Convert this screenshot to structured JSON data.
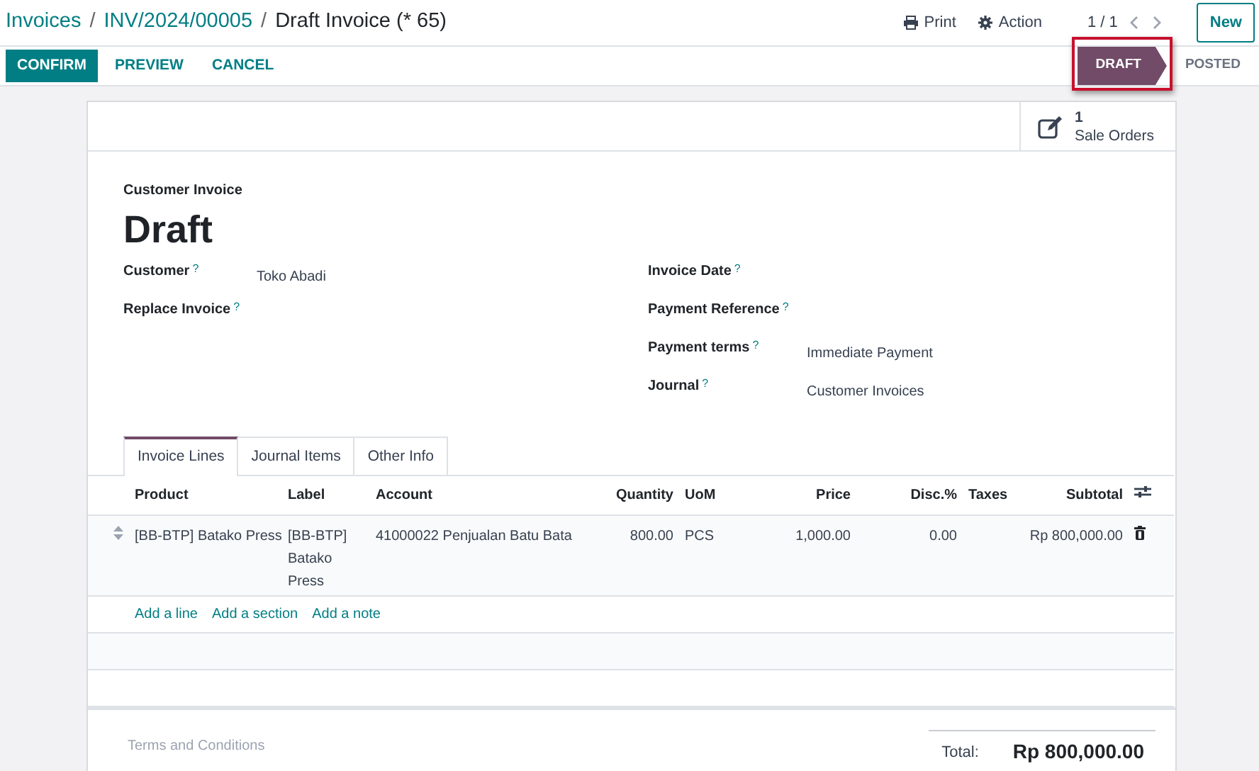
{
  "breadcrumbs": [
    "Invoices",
    "INV/2024/00005",
    "Draft Invoice (* 65)"
  ],
  "breadcrumb_separator": "/",
  "top_actions": [
    {
      "kind": "print",
      "label": "Print"
    },
    {
      "kind": "gear",
      "label": "Action"
    }
  ],
  "pager": "1 / 1",
  "new_button": "New",
  "action_buttons": [
    {
      "label": "CONFIRM",
      "primary": true
    },
    {
      "label": "PREVIEW",
      "primary": false
    },
    {
      "label": "CANCEL",
      "primary": false
    }
  ],
  "statusbar": [
    {
      "label": "DRAFT",
      "selected": true,
      "highlighted": true
    },
    {
      "label": "POSTED",
      "selected": false,
      "highlighted": false
    }
  ],
  "smart_button": {
    "count": "1",
    "label": "Sale Orders"
  },
  "doc_type": "Customer Invoice",
  "doc_title": "Draft",
  "left_fields": [
    {
      "label": "Customer",
      "help": "?",
      "value": "Toko Abadi"
    },
    {
      "label": "Replace Invoice",
      "help": "?"
    }
  ],
  "right_fields": [
    {
      "label": "Invoice Date",
      "help": "?"
    },
    {
      "label": "Payment Reference",
      "help": "?"
    },
    {
      "label": "Payment terms",
      "help": "?",
      "value": "Immediate Payment"
    },
    {
      "label": "Journal",
      "help": "?",
      "value": "Customer Invoices"
    }
  ],
  "tabs": [
    {
      "label": "Invoice Lines",
      "selected": true
    },
    {
      "label": "Journal Items",
      "selected": false
    },
    {
      "label": "Other Info",
      "selected": false
    }
  ],
  "table": {
    "columns": [
      "Product",
      "Label",
      "Account",
      "Quantity",
      "UoM",
      "Price",
      "Disc.%",
      "Taxes",
      "Subtotal"
    ],
    "rows": [
      {
        "cells": [
          "[BB-BTP] Batako Press",
          "[BB-BTP] Batako Press",
          "41000022 Penjualan Batu Bata",
          "800.00",
          "PCS",
          "1,000.00",
          "0.00",
          "",
          "Rp 800,000.00"
        ]
      }
    ],
    "add_links": [
      "Add a line",
      "Add a section",
      "Add a note"
    ]
  },
  "terms_placeholder": "Terms and Conditions",
  "total": {
    "label": "Total:",
    "value": "Rp 800,000.00"
  }
}
